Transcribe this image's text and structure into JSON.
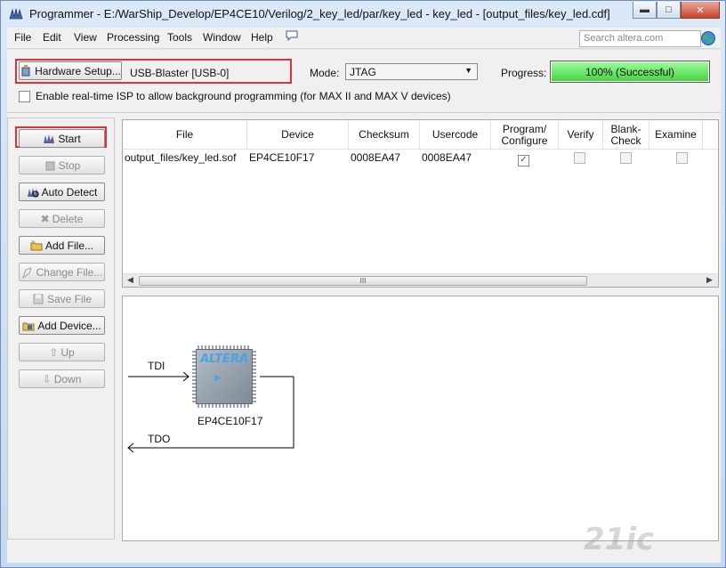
{
  "window": {
    "title": "Programmer - E:/WarShip_Develop/EP4CE10/Verilog/2_key_led/par/key_led - key_led - [output_files/key_led.cdf]",
    "controls": [
      "minimize",
      "maximize",
      "close"
    ]
  },
  "menu": {
    "items": [
      "File",
      "Edit",
      "View",
      "Processing",
      "Tools",
      "Window",
      "Help"
    ],
    "search_placeholder": "Search altera.com"
  },
  "toolbar": {
    "hardware_setup_label": "Hardware Setup...",
    "hardware_value": "USB-Blaster [USB-0]",
    "mode_label": "Mode:",
    "mode_value": "JTAG",
    "progress_label": "Progress:",
    "progress_text": "100% (Successful)",
    "progress_percent": 100,
    "isp_label": "Enable real-time ISP to allow background programming (for MAX II and MAX V devices)",
    "isp_checked": false
  },
  "actions": [
    {
      "label": "Start",
      "enabled": true,
      "icon": "start-icon"
    },
    {
      "label": "Stop",
      "enabled": false,
      "icon": "stop-icon"
    },
    {
      "label": "Auto Detect",
      "enabled": true,
      "icon": "auto-detect-icon"
    },
    {
      "label": "Delete",
      "enabled": false,
      "icon": "delete-icon"
    },
    {
      "label": "Add File...",
      "enabled": true,
      "icon": "add-file-icon"
    },
    {
      "label": "Change File...",
      "enabled": false,
      "icon": "change-file-icon"
    },
    {
      "label": "Save File",
      "enabled": false,
      "icon": "save-file-icon"
    },
    {
      "label": "Add Device...",
      "enabled": true,
      "icon": "add-device-icon"
    },
    {
      "label": "Up",
      "enabled": false,
      "icon": "up-icon"
    },
    {
      "label": "Down",
      "enabled": false,
      "icon": "down-icon"
    }
  ],
  "table": {
    "columns": [
      "File",
      "Device",
      "Checksum",
      "Usercode",
      "Program/ Configure",
      "Verify",
      "Blank- Check",
      "Examine"
    ],
    "rows": [
      {
        "file": "output_files/key_led.sof",
        "device": "EP4CE10F17",
        "checksum": "0008EA47",
        "usercode": "0008EA47",
        "program_configure": true,
        "verify": false,
        "blank_check": false,
        "examine": false
      }
    ],
    "scroll_grip": "III"
  },
  "diagram": {
    "tdi_label": "TDI",
    "tdo_label": "TDO",
    "device_label": "EP4CE10F17",
    "chip_logo": "ALTERA"
  },
  "watermark": "21ic"
}
